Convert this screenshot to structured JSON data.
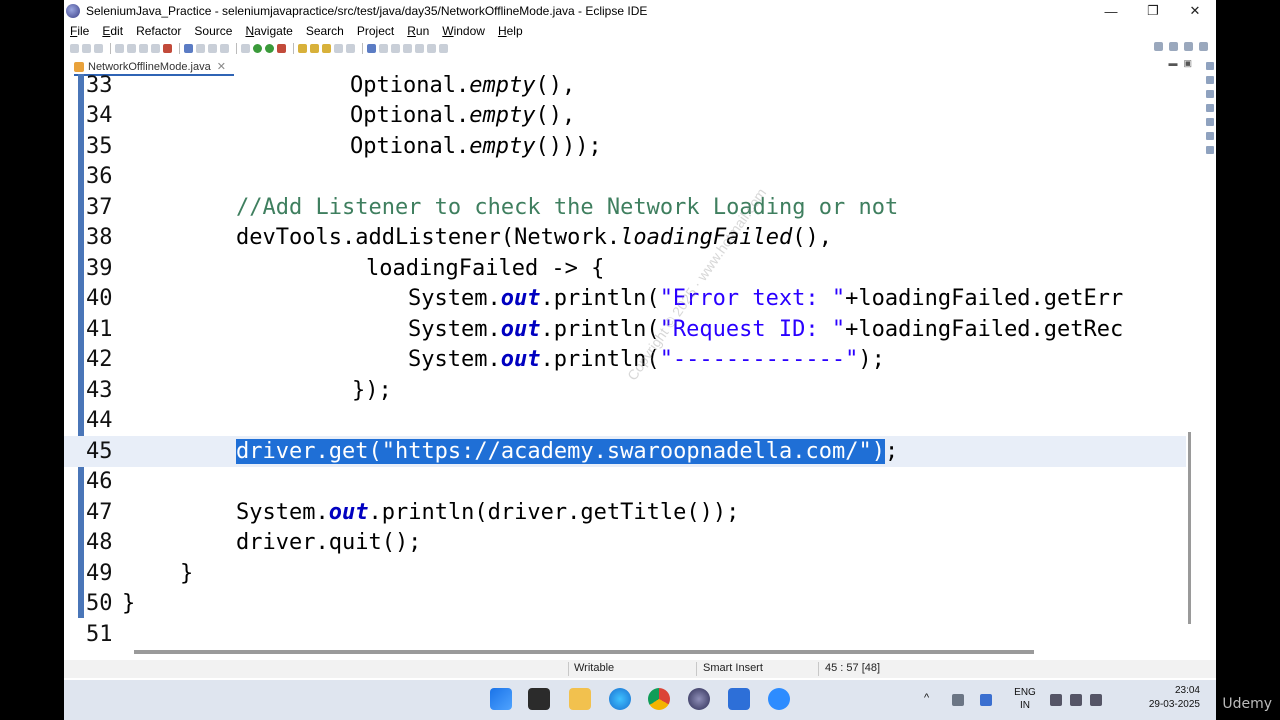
{
  "window": {
    "title": "SeleniumJava_Practice - seleniumjavapractice/src/test/java/day35/NetworkOfflineMode.java - Eclipse IDE",
    "minimize": "—",
    "maximize": "❐",
    "close": "✕"
  },
  "menu": [
    {
      "u": "F",
      "rest": "ile"
    },
    {
      "u": "E",
      "rest": "dit"
    },
    {
      "u": "",
      "rest": "Refactor"
    },
    {
      "u": "",
      "rest": "Source"
    },
    {
      "u": "N",
      "rest": "avigate"
    },
    {
      "u": "",
      "rest": "Search"
    },
    {
      "u": "",
      "rest": "Project"
    },
    {
      "u": "R",
      "rest": "un"
    },
    {
      "u": "W",
      "rest": "indow"
    },
    {
      "u": "H",
      "rest": "elp"
    }
  ],
  "editor": {
    "tab_label": "NetworkOfflineMode.java",
    "tab_close": "✕",
    "line_numbers": [
      "33",
      "34",
      "35",
      "36",
      "37",
      "38",
      "39",
      "40",
      "41",
      "42",
      "43",
      "44",
      "45",
      "46",
      "47",
      "48",
      "49",
      "50",
      "51"
    ],
    "l33": {
      "a": "Optional.",
      "b": "empty",
      "c": "(),"
    },
    "l34": {
      "a": "Optional.",
      "b": "empty",
      "c": "(),"
    },
    "l35": {
      "a": "Optional.",
      "b": "empty",
      "c": "()));"
    },
    "l37": {
      "a": "//Add Listener to check the Network Loading or not"
    },
    "l38": {
      "a": "devTools.addListener(Network.",
      "b": "loadingFailed",
      "c": "(),"
    },
    "l39": {
      "a": "loadingFailed -> {"
    },
    "l40": {
      "a": "System.",
      "b": "out",
      "c": ".println(",
      "d": "\"Error text: \"",
      "e": "+loadingFailed.getErr"
    },
    "l41": {
      "a": "System.",
      "b": "out",
      "c": ".println(",
      "d": "\"Request ID: \"",
      "e": "+loadingFailed.getRec"
    },
    "l42": {
      "a": "System.",
      "b": "out",
      "c": ".println(",
      "d": "\"-------------\"",
      "e": ");"
    },
    "l43": {
      "a": "});"
    },
    "l45": {
      "a": "driver.get(",
      "b": "\"https://academy.swaroopnadella.com/\"",
      "c": ")",
      "d": ";"
    },
    "l47": {
      "a": "System.",
      "b": "out",
      "c": ".println(driver.getTitle());"
    },
    "l48": {
      "a": "driver.quit();"
    },
    "l49": {
      "a": "}"
    },
    "l50": {
      "a": "}"
    }
  },
  "watermark": "Copyright © 2025 · www.hotmail.com",
  "status": {
    "writable": "Writable",
    "insert_mode": "Smart Insert",
    "position": "45 : 57 [48]"
  },
  "taskbar": {
    "lang_top": "ENG",
    "lang_bottom": "IN",
    "time": "23:04",
    "date": "29-03-2025"
  },
  "overlay": {
    "brand": "Udemy"
  },
  "colors": {
    "selection": "#1f6fd6",
    "comment": "#3f7f5f",
    "string": "#2a00ff",
    "field": "#0000c0"
  }
}
